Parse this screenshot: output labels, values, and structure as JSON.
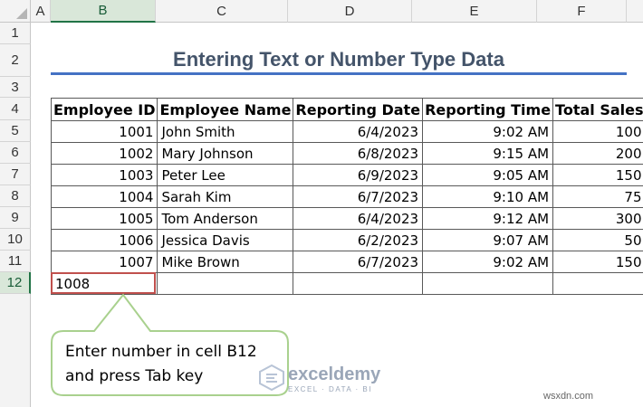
{
  "columns": [
    "A",
    "B",
    "C",
    "D",
    "E",
    "F"
  ],
  "active_column": "B",
  "rows": [
    "1",
    "2",
    "3",
    "4",
    "5",
    "6",
    "7",
    "8",
    "9",
    "10",
    "11",
    "12"
  ],
  "active_row": "12",
  "title": "Entering Text or Number Type Data",
  "table": {
    "headers": [
      "Employee ID",
      "Employee Name",
      "Reporting Date",
      "Reporting Time",
      "Total Sales"
    ],
    "rows": [
      [
        "1001",
        "John Smith",
        "6/4/2023",
        "9:02 AM",
        "100"
      ],
      [
        "1002",
        "Mary Johnson",
        "6/8/2023",
        "9:15 AM",
        "200"
      ],
      [
        "1003",
        "Peter Lee",
        "6/9/2023",
        "9:05 AM",
        "150"
      ],
      [
        "1004",
        "Sarah Kim",
        "6/7/2023",
        "9:10 AM",
        "75"
      ],
      [
        "1005",
        "Tom Anderson",
        "6/4/2023",
        "9:12 AM",
        "300"
      ],
      [
        "1006",
        "Jessica Davis",
        "6/2/2023",
        "9:07 AM",
        "50"
      ],
      [
        "1007",
        "Mike Brown",
        "6/7/2023",
        "9:02 AM",
        "150"
      ]
    ],
    "entry_value": "1008"
  },
  "callout": {
    "line1": "Enter number in cell B12",
    "line2": "and press Tab key"
  },
  "watermark": {
    "name": "exceldemy",
    "tagline": "EXCEL · DATA · BI"
  },
  "site": "wsxdn.com",
  "colors": {
    "title": "#44546a",
    "title_rule": "#4472c4",
    "selection_border": "#c0504d",
    "callout_border": "#a9d18e",
    "active_header": "#217346"
  }
}
